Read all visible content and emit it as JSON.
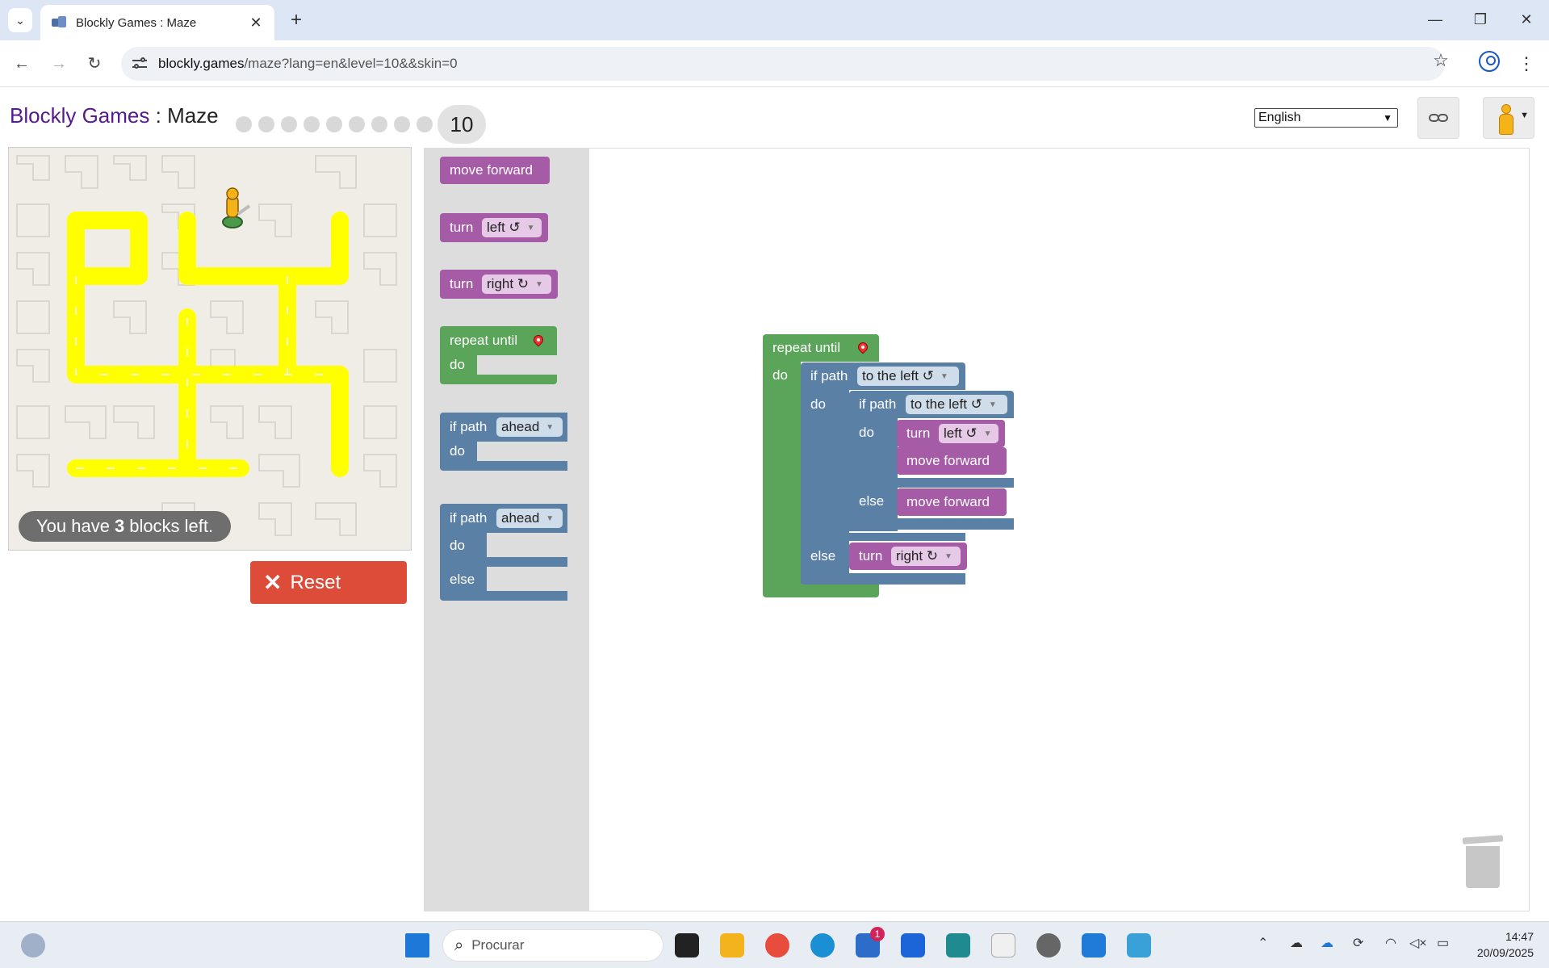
{
  "browser": {
    "tab_title": "Blockly Games : Maze",
    "tab_close": "✕",
    "new_tab": "+",
    "url_host": "blockly.games",
    "url_path": "/maze?lang=en&level=10&&skin=0",
    "window_controls": [
      "—",
      "❐",
      "✕"
    ]
  },
  "header": {
    "brand_games": "Blockly Games",
    "brand_sep": " : ",
    "brand_app": "Maze",
    "current_level": "10",
    "completed_levels": 9,
    "language": "English"
  },
  "maze": {
    "blocks_left_pre": "You have",
    "blocks_left_count": "3",
    "blocks_left_post": "blocks left.",
    "reset_label": "Reset"
  },
  "flyout": {
    "move_forward": "move forward",
    "turn": "turn",
    "left": "left ↺",
    "right": "right ↻",
    "repeat_until": "repeat until",
    "do": "do",
    "if_path": "if path",
    "ahead": "ahead",
    "else": "else"
  },
  "program": {
    "repeat_until": "repeat until",
    "do": "do",
    "if_path": "if path",
    "to_the_left": "to the left ↺",
    "turn": "turn",
    "left": "left ↺",
    "right": "right ↻",
    "move_forward": "move forward",
    "else": "else"
  },
  "taskbar": {
    "search_placeholder": "Procurar",
    "store_badge": "1",
    "time": "14:47",
    "date": "20/09/2025"
  },
  "colors": {
    "motion_block": "#a55ba5",
    "logic_block": "#5b80a5",
    "loop_block": "#5ba55b",
    "path": "#ffff00",
    "reset": "#dd4b39"
  }
}
